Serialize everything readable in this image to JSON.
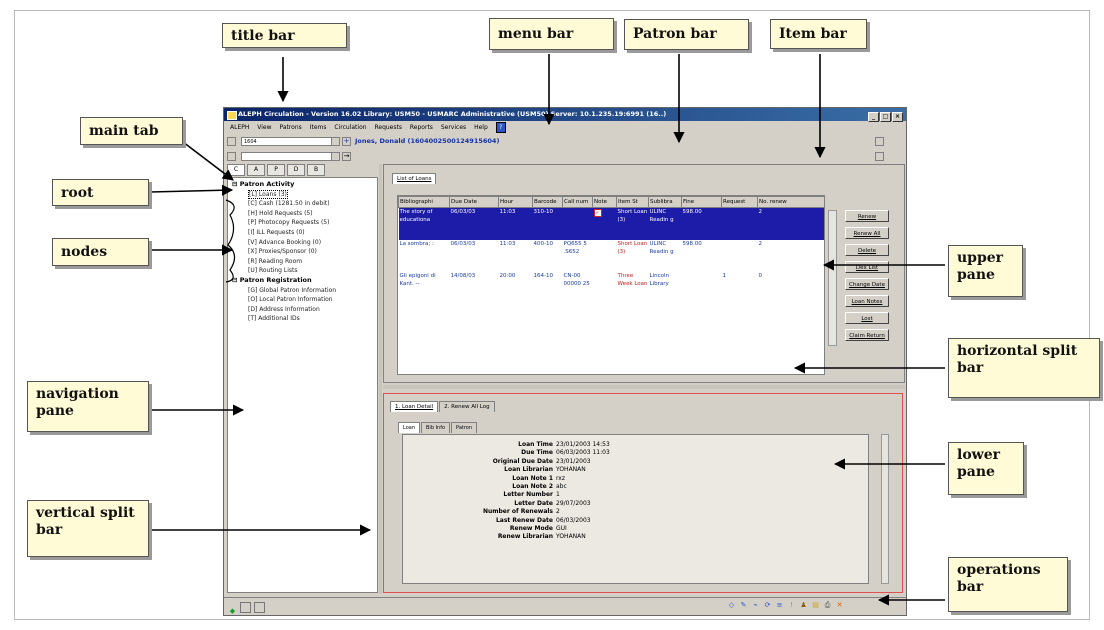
{
  "callouts": {
    "title_bar": "title  bar",
    "menu_bar": "menu bar",
    "patron_bar": "Patron bar",
    "item_bar": "Item bar",
    "main_tab": "main tab",
    "root": "root",
    "nodes": "nodes",
    "navigation_pane": "navigation pane",
    "vertical_split_bar": "vertical split bar",
    "upper_pane": "upper pane",
    "horizontal_split_bar": "horizontal split bar",
    "lower_pane": "lower pane",
    "operations_bar": "operations bar"
  },
  "window": {
    "title": "ALEPH Circulation - Version 16.02        Library: USM50 - USMARC Administrative (USM50)        Server: 10.1.235.19:6991 (16..)"
  },
  "menu": [
    "ALEPH",
    "View",
    "Patrons",
    "Items",
    "Circulation",
    "Requests",
    "Reports",
    "Services",
    "Help"
  ],
  "help_glyph": "?",
  "patron_bar": {
    "id_value": "1604",
    "name": "Jones, Donald (1604002500124915604)"
  },
  "icons": {
    "patron_plus": "+",
    "item_arrow": "→",
    "title_app": "aleph-app-icon",
    "window_controls": [
      "_",
      "□",
      "×"
    ]
  },
  "nav_tabs": [
    "C",
    "A",
    "P",
    "D",
    "B"
  ],
  "tree": {
    "root1": "Patron Activity",
    "nodes1": [
      "[L] Loans (3)",
      "[C] Cash (1281.50 in debit)",
      "[H] Hold Requests (5)",
      "[P] Photocopy Requests (5)",
      "[I] ILL Requests (0)",
      "[V] Advance Booking (0)",
      "[X] Proxies/Sponsor (0)",
      "[R] Reading Room",
      "[U] Routing Lists"
    ],
    "root2": "Patron Registration",
    "nodes2": [
      "[G] Global Patron Information",
      "[O] Local Patron Information",
      "[D] Address Information",
      "[T] Additional IDs"
    ]
  },
  "upper": {
    "tab": "List of Loans",
    "headers": [
      "Bibliographi",
      "Due Date",
      "Hour",
      "Barcode",
      "Call num",
      "Note",
      "Item St",
      "Sublibra",
      "Fine",
      "Request",
      "No. renew"
    ],
    "rows": [
      {
        "bib": "The story of educationa",
        "due": "06/03/03",
        "hour": "11:03",
        "barcode": "310-10",
        "call": "",
        "note": "✓",
        "status": "Short Loan (3)",
        "sublib": "ULINC Readin g",
        "fine": "598.00",
        "req": "",
        "renew": "2"
      },
      {
        "bib": "La sombra; :",
        "due": "06/03/03",
        "hour": "11:03",
        "barcode": "400-10",
        "call": "PQ655 5 .S652",
        "note": "",
        "status": "Short Loan (3)",
        "sublib": "ULINC Readin g",
        "fine": "598.00",
        "req": "",
        "renew": "2"
      },
      {
        "bib": "Gli epigoni di Kant. --",
        "due": "14/08/03",
        "hour": "20:00",
        "barcode": "164-10",
        "call": "CN-00 00000 25",
        "note": "",
        "status": "Three Week Loan",
        "sublib": "Lincoln Library",
        "fine": "",
        "req": "1",
        "renew": "0"
      }
    ],
    "buttons": [
      "Renew",
      "Renew All",
      "Delete",
      "Dex List",
      "Change Date",
      "Loan Notes",
      "Lost",
      "Claim Return"
    ]
  },
  "lower": {
    "tabs": [
      "1. Loan Detail",
      "2. Renew All Log"
    ],
    "subtabs": [
      "Loan",
      "Bib Info",
      "Patron"
    ],
    "details": [
      {
        "label": "Loan Time",
        "value": "23/01/2003 14:53"
      },
      {
        "label": "Due Time",
        "value": "06/03/2003 11:03"
      },
      {
        "label": "Original Due Date",
        "value": "23/01/2003"
      },
      {
        "label": "Loan Librarian",
        "value": "YOHANAN"
      },
      {
        "label": "Loan Note 1",
        "value": "rxz"
      },
      {
        "label": "Loan Note 2",
        "value": "abc"
      },
      {
        "label": "Letter Number",
        "value": "1"
      },
      {
        "label": "Letter Date",
        "value": "29/07/2003"
      },
      {
        "label": "Number of Renewals",
        "value": "2"
      },
      {
        "label": "Last Renew Date",
        "value": "06/03/2003"
      },
      {
        "label": "Renew Mode",
        "value": "GUI"
      },
      {
        "label": "Renew Librarian",
        "value": "YOHANAN"
      }
    ]
  },
  "colors": {
    "title_bar": "#0a246a",
    "selected_row": "#1c1ca8",
    "patron_name": "#1432a8",
    "lower_border": "#e05050",
    "callout_bg": "#fffbd6"
  }
}
